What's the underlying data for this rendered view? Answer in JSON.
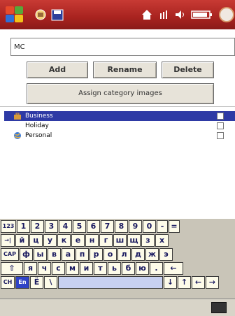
{
  "toolbar": {
    "colors": {
      "title_bar": "#b22a25",
      "selection": "#2e3aa5"
    }
  },
  "input": {
    "value": "MC"
  },
  "buttons": {
    "add": "Add",
    "rename": "Rename",
    "delete": "Delete",
    "assign": "Assign category images"
  },
  "categories": [
    {
      "label": "Business",
      "icon": "briefcase-icon",
      "selected": true
    },
    {
      "label": "Holiday",
      "icon": "",
      "selected": false
    },
    {
      "label": "Personal",
      "icon": "globe-icon",
      "selected": false
    }
  ],
  "keyboard": {
    "row1": [
      "123",
      "1",
      "2",
      "3",
      "4",
      "5",
      "6",
      "7",
      "8",
      "9",
      "0",
      "-",
      "="
    ],
    "row2": [
      "→|",
      "й",
      "ц",
      "у",
      "к",
      "е",
      "н",
      "г",
      "ш",
      "щ",
      "з",
      "х"
    ],
    "row3": [
      "CAP",
      "ф",
      "ы",
      "в",
      "а",
      "п",
      "р",
      "о",
      "л",
      "д",
      "ж",
      "э"
    ],
    "row4": [
      "⇧",
      "я",
      "ч",
      "с",
      "м",
      "и",
      "т",
      "ь",
      "б",
      "ю",
      ".",
      "←"
    ],
    "row5": [
      "CH",
      "En",
      "Ë",
      "\\",
      "",
      "↓",
      "↑",
      "←",
      "→"
    ]
  }
}
